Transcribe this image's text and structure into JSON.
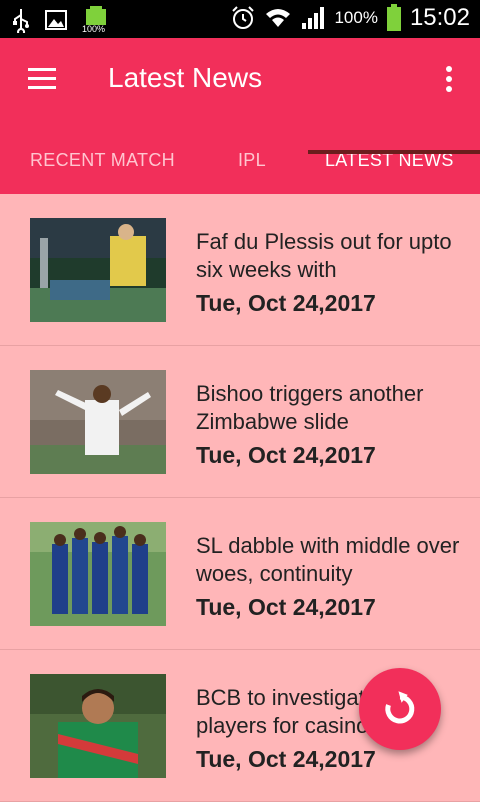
{
  "status_bar": {
    "battery_small_label": "100%",
    "battery_percent": "100%",
    "time": "15:02"
  },
  "app_bar": {
    "title": "Latest News"
  },
  "tabs": [
    {
      "label": "RECENT MATCH",
      "active": false
    },
    {
      "label": "IPL",
      "active": false
    },
    {
      "label": "LATEST NEWS",
      "active": true
    }
  ],
  "news": [
    {
      "headline": "Faf du Plessis out for upto six weeks with",
      "date": "Tue, Oct 24,2017"
    },
    {
      "headline": "Bishoo triggers another Zimbabwe slide",
      "date": "Tue, Oct 24,2017"
    },
    {
      "headline": "SL dabble with middle over woes, continuity",
      "date": "Tue, Oct 24,2017"
    },
    {
      "headline": "BCB to investigate three players for casino visit",
      "date": "Tue, Oct 24,2017"
    }
  ],
  "colors": {
    "primary": "#f22f5a",
    "background": "#ffb6b8",
    "status_bar": "#000000"
  },
  "icons": {
    "menu": "hamburger-icon",
    "more": "overflow-menu-icon",
    "fab": "refresh-icon"
  }
}
